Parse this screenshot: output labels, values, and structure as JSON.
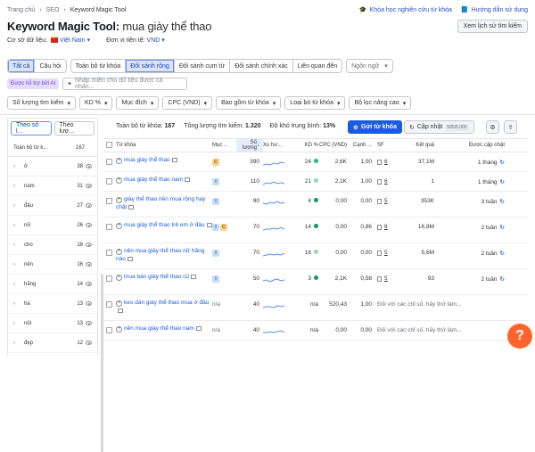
{
  "breadcrumb": [
    "Trang chủ",
    "SEO",
    "Keyword Magic Tool"
  ],
  "top_links": {
    "course": "Khóa học nghiên cứu từ khóa",
    "guide": "Hướng dẫn sử dụng"
  },
  "title": {
    "tool": "Keyword Magic Tool:",
    "keyword": "mua giày thể thao"
  },
  "history_button": "Xem lịch sử tìm kiếm",
  "database": {
    "label": "Cơ sở dữ liệu:",
    "value": "Việt Nam",
    "currency_label": "Đơn vị tiền tệ:",
    "currency": "VND"
  },
  "match_tabs": {
    "group1": [
      "Tất cả",
      "Câu hỏi"
    ],
    "group2": [
      "Toàn bộ từ khóa",
      "Đối sánh rộng",
      "Đối sánh cụm từ",
      "Đối sánh chính xác",
      "Liên quan đến"
    ],
    "active": "Đối sánh rộng",
    "language": "Ngôn ngữ"
  },
  "ai": {
    "badge": "Được hỗ trợ bởi AI",
    "placeholder": "Nhập miền cho dữ liệu được cá nhân..."
  },
  "filters": [
    "Số lượng tìm kiếm",
    "KD %",
    "Mục đích",
    "CPC (VND)",
    "Bao gồm từ khóa",
    "Loại bỏ từ khóa",
    "Bộ lọc nâng cao"
  ],
  "left_panel": {
    "tabs": [
      "Theo số l...",
      "Theo lượ..."
    ],
    "header": {
      "label": "Toàn bộ từ k...",
      "count": "167"
    },
    "groups": [
      {
        "word": "ở",
        "count": "38"
      },
      {
        "word": "nam",
        "count": "31"
      },
      {
        "word": "đâu",
        "count": "27"
      },
      {
        "word": "nữ",
        "count": "26"
      },
      {
        "word": "cho",
        "count": "18"
      },
      {
        "word": "nên",
        "count": "16"
      },
      {
        "word": "hãng",
        "count": "14"
      },
      {
        "word": "hà",
        "count": "13"
      },
      {
        "word": "nội",
        "count": "13"
      },
      {
        "word": "đẹp",
        "count": "12"
      }
    ]
  },
  "summary": {
    "total_label": "Toàn bộ từ khóa:",
    "total": "167",
    "volume_label": "Tổng lượng tìm kiếm:",
    "volume": "1.320",
    "kd_label": "Độ khó trung bình:",
    "kd": "13%"
  },
  "actions": {
    "send": "Gửi từ khóa",
    "update": "Cập nhật",
    "quota": "585/5.000"
  },
  "table": {
    "headers": [
      "Từ khóa",
      "Mục ...",
      "Số lượng",
      "Xu hư...",
      "KD %",
      "CPC (VND)",
      "Cạnh ...",
      "SF",
      "Kết quả",
      "Được cập nhật"
    ],
    "rows": [
      {
        "keyword": "mua giày thể thao",
        "intent": [
          "C"
        ],
        "volume": "390",
        "kd": "24",
        "kd_color": "#1fbe7a",
        "cpc": "2,6K",
        "com": "1,00",
        "sf": "6",
        "results": "37,1M",
        "updated": "1 tháng"
      },
      {
        "keyword": "mua giày thể thao nam",
        "intent": [
          "I"
        ],
        "volume": "110",
        "kd": "21",
        "kd_color": "#8ed8b1",
        "cpc": "2,1K",
        "com": "1,00",
        "sf": "6",
        "results": "1",
        "updated": "1 tháng"
      },
      {
        "keyword": "giày thể thao nên mua rộng hay chật",
        "intent": [
          "I"
        ],
        "volume": "90",
        "kd": "4",
        "kd_color": "#0f9a63",
        "cpc": "0,00",
        "com": "0,00",
        "sf": "5",
        "results": "353K",
        "updated": "3 tuần"
      },
      {
        "keyword": "mua giày thể thao trẻ em ở đâu",
        "intent": [
          "I",
          "C"
        ],
        "volume": "70",
        "kd": "14",
        "kd_color": "#0f9a63",
        "cpc": "0,00",
        "com": "0,86",
        "sf": "6",
        "results": "16,8M",
        "updated": "2 tuần"
      },
      {
        "keyword": "nên mua giày thể thao nữ hãng nào",
        "intent": [
          "I"
        ],
        "volume": "70",
        "kd": "16",
        "kd_color": "#8ed8b1",
        "cpc": "0,00",
        "com": "0,00",
        "sf": "5",
        "results": "5,6M",
        "updated": "2 tuần"
      },
      {
        "keyword": "mua bán giày thể thao cũ",
        "intent": [
          "I"
        ],
        "volume": "50",
        "kd": "3",
        "kd_color": "#0f9a63",
        "cpc": "2,1K",
        "com": "0,58",
        "sf": "5",
        "results": "93",
        "updated": "2 tuần"
      },
      {
        "keyword": "keo dán giày thể thao mua ở đâu",
        "intent": [],
        "volume": "40",
        "kd": "n/a",
        "kd_color": "",
        "cpc": "520,43",
        "com": "1,00",
        "sf": "",
        "results": "Đối với các chỉ số, hãy thử làm...",
        "updated": ""
      },
      {
        "keyword": "nên mua giày thể thao nam",
        "intent": [],
        "volume": "40",
        "kd": "n/a",
        "kd_color": "",
        "cpc": "0,00",
        "com": "0,00",
        "sf": "",
        "results": "Đối với các chỉ số, hãy thử làm...",
        "updated": ""
      }
    ]
  },
  "help": "?"
}
